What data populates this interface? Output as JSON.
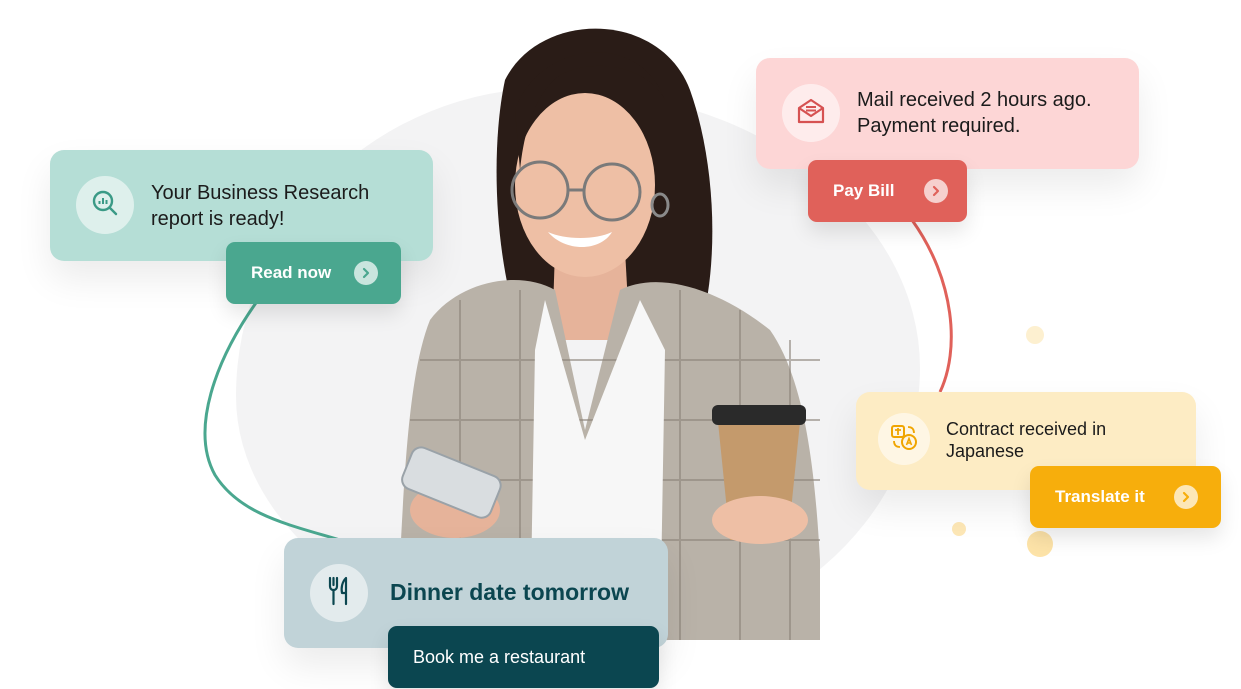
{
  "colors": {
    "research_card": "#b5ded6",
    "research_action": "#4aa78f",
    "mail_card": "#fdd6d6",
    "mail_action": "#e0615a",
    "contract_card": "#fdecc4",
    "contract_action": "#f7ae0c",
    "dinner_card": "#c1d3d8",
    "dinner_action": "#0b4650",
    "blob": "#f3f3f4"
  },
  "notifications": {
    "research": {
      "icon": "search-chart-icon",
      "line1": "Your Business Research",
      "line2": "report is ready!",
      "action_label": "Read now",
      "action_icon": "chevron-right-icon"
    },
    "mail": {
      "icon": "envelope-icon",
      "line1": "Mail received 2 hours ago.",
      "line2": "Payment required.",
      "action_label": "Pay Bill",
      "action_icon": "chevron-right-icon"
    },
    "contract": {
      "icon": "translate-icon",
      "line1": "Contract received in",
      "line2": "Japanese",
      "action_label": "Translate it",
      "action_icon": "chevron-right-icon"
    },
    "dinner": {
      "icon": "fork-knife-icon",
      "title": "Dinner date tomorrow",
      "action_label": "Book me a restaurant"
    }
  }
}
